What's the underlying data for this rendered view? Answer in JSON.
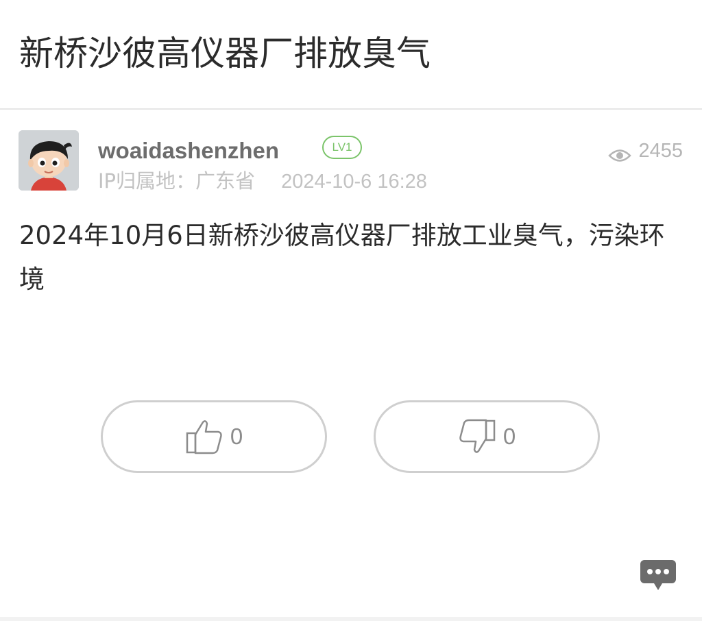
{
  "page": {
    "title": "新桥沙彼高仪器厂排放臭气"
  },
  "author": {
    "name": "woaidashenzhen",
    "level": "LV1",
    "ip_label": "IP归属地：",
    "ip_location": "广东省",
    "post_time": "2024-10-6 16:28",
    "avatar_icon": "cartoon-boy-avatar"
  },
  "stats": {
    "views": "2455",
    "views_icon": "eye-icon"
  },
  "post": {
    "body": "2024年10月6日新桥沙彼高仪器厂排放工业臭气，污染环境"
  },
  "votes": {
    "like_count": "0",
    "dislike_count": "0",
    "like_icon": "thumbs-up-icon",
    "dislike_icon": "thumbs-down-icon"
  },
  "fab": {
    "icon": "comment-bubble-icon"
  },
  "colors": {
    "title_text": "#2b2b2b",
    "muted_text": "#c2c2c2",
    "author_text": "#6d6d6d",
    "level_green": "#7bc46a",
    "border_gray": "#cfcfcf",
    "fab_gray": "#6b6b6b"
  }
}
